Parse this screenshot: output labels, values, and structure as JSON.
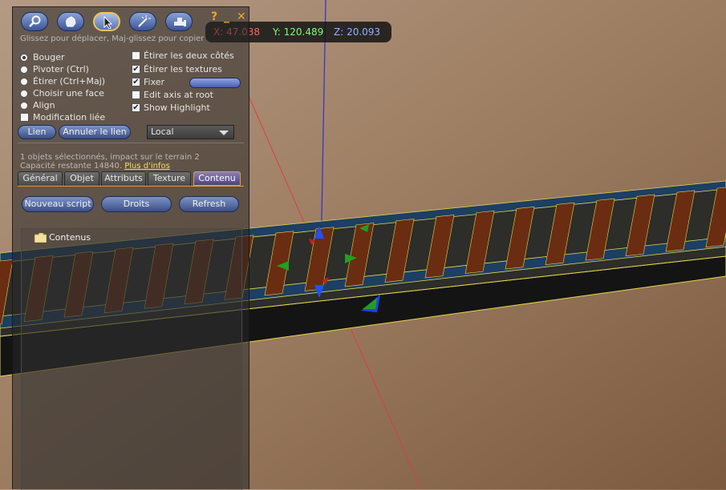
{
  "viewport": {
    "coords": {
      "x": "X: 47.038",
      "y": "Y: 120.489",
      "z": "Z: 20.093"
    }
  },
  "toolbar": {
    "tools": [
      {
        "name": "focus",
        "icon": "magnifier-icon",
        "active": false
      },
      {
        "name": "move",
        "icon": "hand-icon",
        "active": false
      },
      {
        "name": "edit",
        "icon": "arrow-pointer-icon",
        "active": true
      },
      {
        "name": "create",
        "icon": "magic-wand-icon",
        "active": false
      },
      {
        "name": "land",
        "icon": "bulldozer-icon",
        "active": false
      }
    ],
    "help_label": "?",
    "minimize_label": "_",
    "close_label": "✕"
  },
  "hint": "Glissez pour déplacer, Maj-glissez pour copier",
  "edit_modes": [
    {
      "label": "Bouger",
      "selected": true
    },
    {
      "label": "Pivoter (Ctrl)",
      "selected": false
    },
    {
      "label": "Étirer (Ctrl+Maj)",
      "selected": false
    },
    {
      "label": "Choisir une face",
      "selected": false
    },
    {
      "label": "Align",
      "selected": false
    }
  ],
  "linked_edit": {
    "label": "Modification liée",
    "checked": false
  },
  "options": [
    {
      "label": "Étirer les deux côtés",
      "checked": false
    },
    {
      "label": "Étirer les textures",
      "checked": true
    },
    {
      "label": "Fixer",
      "checked": true
    },
    {
      "label": "Edit axis at root",
      "checked": false
    },
    {
      "label": "Show Highlight",
      "checked": true
    }
  ],
  "buttons": {
    "link": "Lien",
    "unlink": "Annuler le lien"
  },
  "ruler_mode": {
    "selected": "Local"
  },
  "selection_info": {
    "line1": "1 objets sélectionnés, impact sur le terrain 2",
    "line2": "Capacité restante 14840.",
    "more_info": "Plus d'infos"
  },
  "tabs": [
    {
      "label": "Général",
      "active": false
    },
    {
      "label": "Objet",
      "active": false
    },
    {
      "label": "Attributs",
      "active": false
    },
    {
      "label": "Texture",
      "active": false
    },
    {
      "label": "Contenu",
      "active": true
    }
  ],
  "contents": {
    "new_script": "Nouveau script",
    "permissions": "Droits",
    "refresh": "Refresh",
    "folder_label": "Contenus"
  },
  "colors": {
    "accent": "#e0a030",
    "button": "#5671b4",
    "axis_x": "#ff3030",
    "axis_y": "#30c030",
    "axis_z": "#3030ff",
    "highlight": "#e6d84a"
  }
}
